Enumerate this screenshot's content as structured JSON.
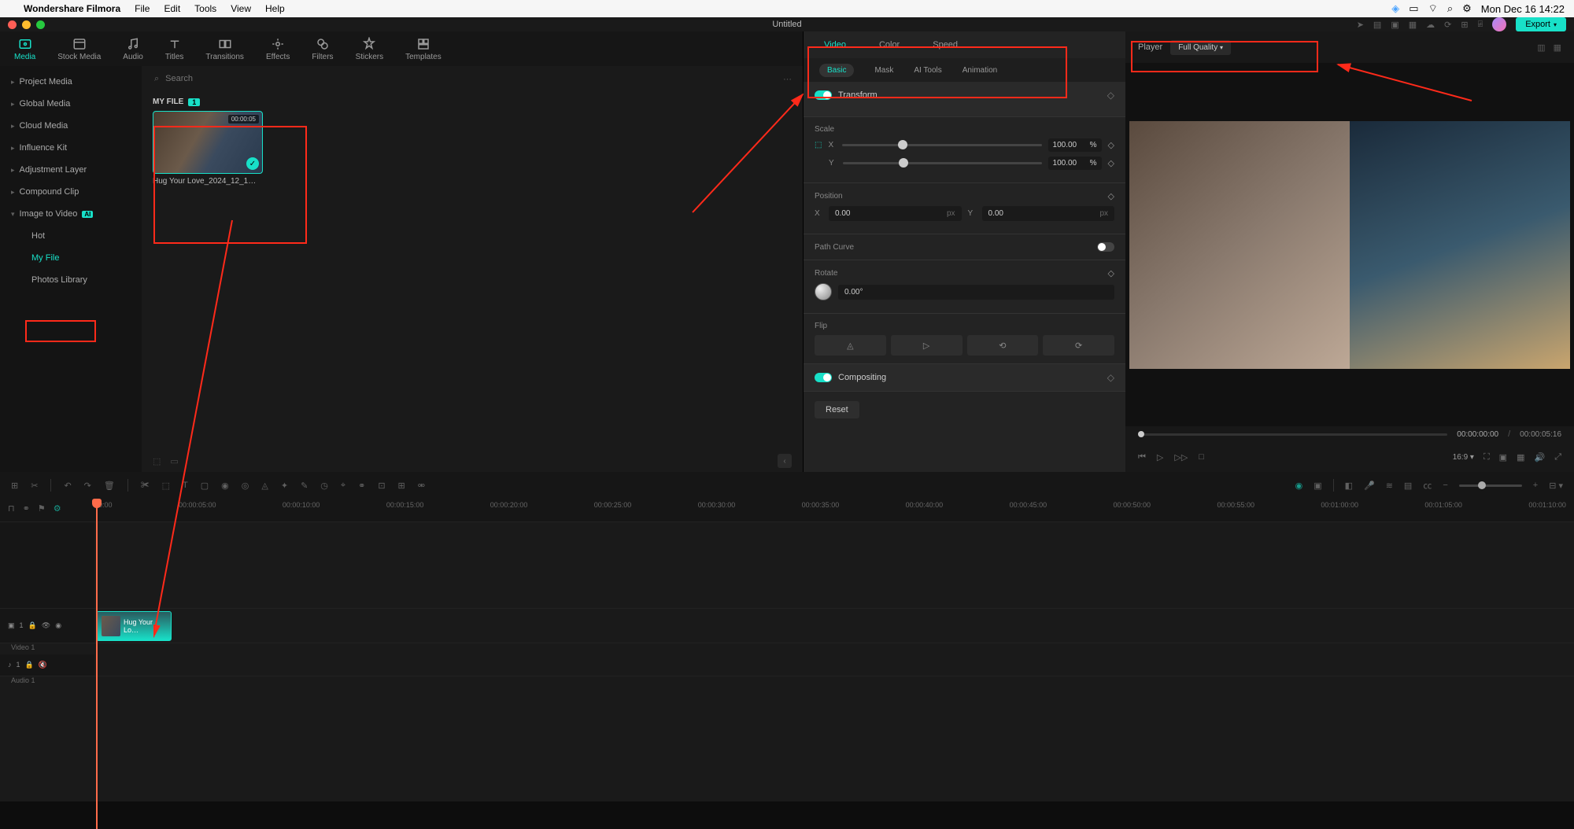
{
  "macmenu": {
    "app": "Wondershare Filmora",
    "items": [
      "File",
      "Edit",
      "Tools",
      "View",
      "Help"
    ],
    "clock": "Mon Dec 16  14:22"
  },
  "window": {
    "title": "Untitled"
  },
  "topstrip": {
    "export": "Export"
  },
  "mediaTabs": [
    "Media",
    "Stock Media",
    "Audio",
    "Titles",
    "Transitions",
    "Effects",
    "Filters",
    "Stickers",
    "Templates"
  ],
  "sidebar": {
    "items": [
      "Project Media",
      "Global Media",
      "Cloud Media",
      "Influence Kit",
      "Adjustment Layer",
      "Compound Clip"
    ],
    "image2video": "Image to Video",
    "hot": "Hot",
    "myfile": "My File",
    "photos": "Photos Library"
  },
  "search": {
    "placeholder": "Search"
  },
  "grid": {
    "header": "MY FILE",
    "count": "1",
    "thumb": {
      "duration": "00:00:05",
      "name": "Hug Your Love_2024_12_1…"
    }
  },
  "inspector": {
    "tabs": [
      "Video",
      "Color",
      "Speed"
    ],
    "subtabs": [
      "Basic",
      "Mask",
      "AI Tools",
      "Animation"
    ],
    "transform": "Transform",
    "scale": "Scale",
    "scaleX": "100.00",
    "scaleY": "100.00",
    "pct": "%",
    "position": "Position",
    "posX": "0.00",
    "posY": "0.00",
    "px": "px",
    "pathcurve": "Path Curve",
    "rotate": "Rotate",
    "rotateVal": "0.00°",
    "flip": "Flip",
    "compositing": "Compositing",
    "reset": "Reset",
    "x": "X",
    "y": "Y"
  },
  "preview": {
    "player": "Player",
    "quality": "Full Quality",
    "time_current": "00:00:00:00",
    "time_total": "00:00:05:16",
    "aspect": "16:9"
  },
  "timeline": {
    "ticks": [
      "00:00",
      "00:00:05:00",
      "00:00:10:00",
      "00:00:15:00",
      "00:00:20:00",
      "00:00:25:00",
      "00:00:30:00",
      "00:00:35:00",
      "00:00:40:00",
      "00:00:45:00",
      "00:00:50:00",
      "00:00:55:00",
      "00:01:00:00",
      "00:01:05:00",
      "00:01:10:00"
    ],
    "video_track": "Video 1",
    "audio_track": "Audio 1",
    "clip_name": "Hug Your Lo…"
  }
}
